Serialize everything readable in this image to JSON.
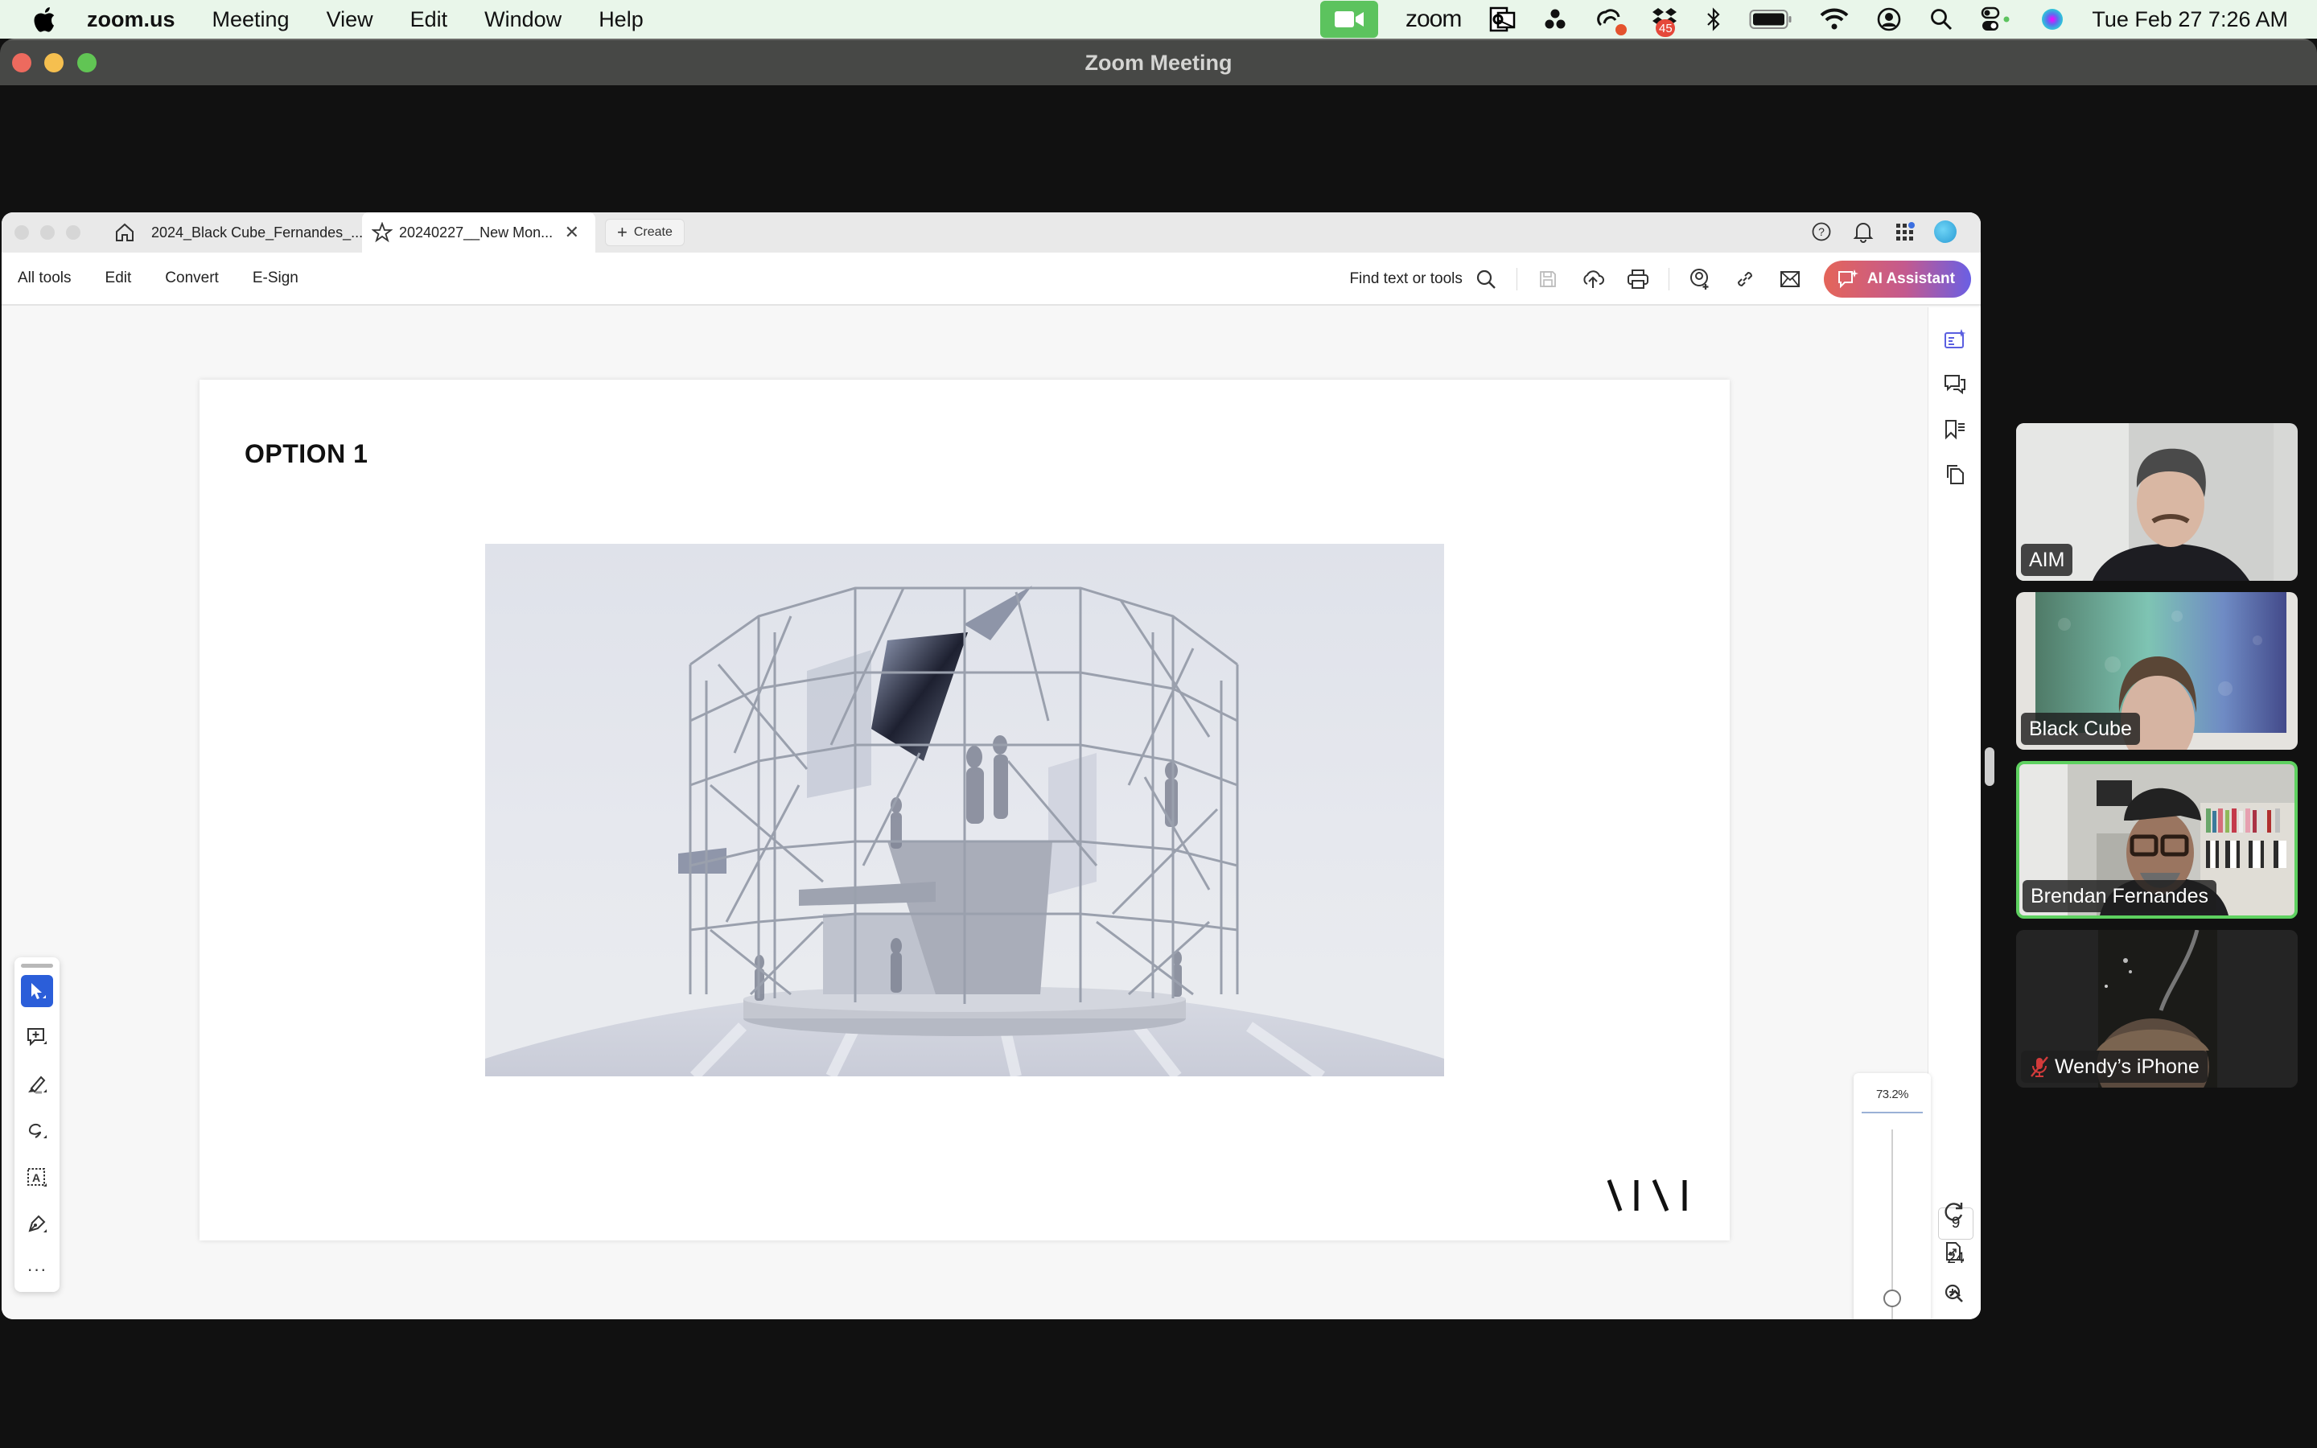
{
  "menubar": {
    "app_name": "zoom.us",
    "menus": [
      "Meeting",
      "View",
      "Edit",
      "Window",
      "Help"
    ],
    "tray": {
      "zoom_label": "zoom",
      "dropbox_badge": "45",
      "datetime": "Tue Feb 27  7:26 AM"
    }
  },
  "zoom_window": {
    "title": "Zoom Meeting"
  },
  "acrobat": {
    "tabs": [
      {
        "label": "2024_Black Cube_Fernandes_...",
        "active": false
      },
      {
        "label": "20240227__New Mon...",
        "active": true
      }
    ],
    "create_label": "Create",
    "toolbar_menus": [
      "All tools",
      "Edit",
      "Convert",
      "E-Sign"
    ],
    "find_label": "Find text or tools",
    "ai_assistant_label": "AI Assistant",
    "accent_color": "#2b5ed9",
    "page": {
      "title": "OPTION 1",
      "image_alt": "Rendering of a mirrored scaffold pavilion with figures on a platform",
      "logo_text": "AIM"
    },
    "navigation": {
      "current_page": "9",
      "total_pages": "24"
    },
    "zoom_level": "73.2%",
    "zoom_slider_fraction": 0.82
  },
  "participants": [
    {
      "name": "AIM",
      "speaking": false,
      "muted": false
    },
    {
      "name": "Black Cube",
      "speaking": false,
      "muted": false
    },
    {
      "name": "Brendan Fernandes",
      "speaking": true,
      "muted": false
    },
    {
      "name": "Wendy’s iPhone",
      "speaking": false,
      "muted": true
    }
  ],
  "colors": {
    "speaking_border": "#5ed160",
    "menubar_bg": "#e9f6ea",
    "zoom_green": "#5cc35e"
  }
}
